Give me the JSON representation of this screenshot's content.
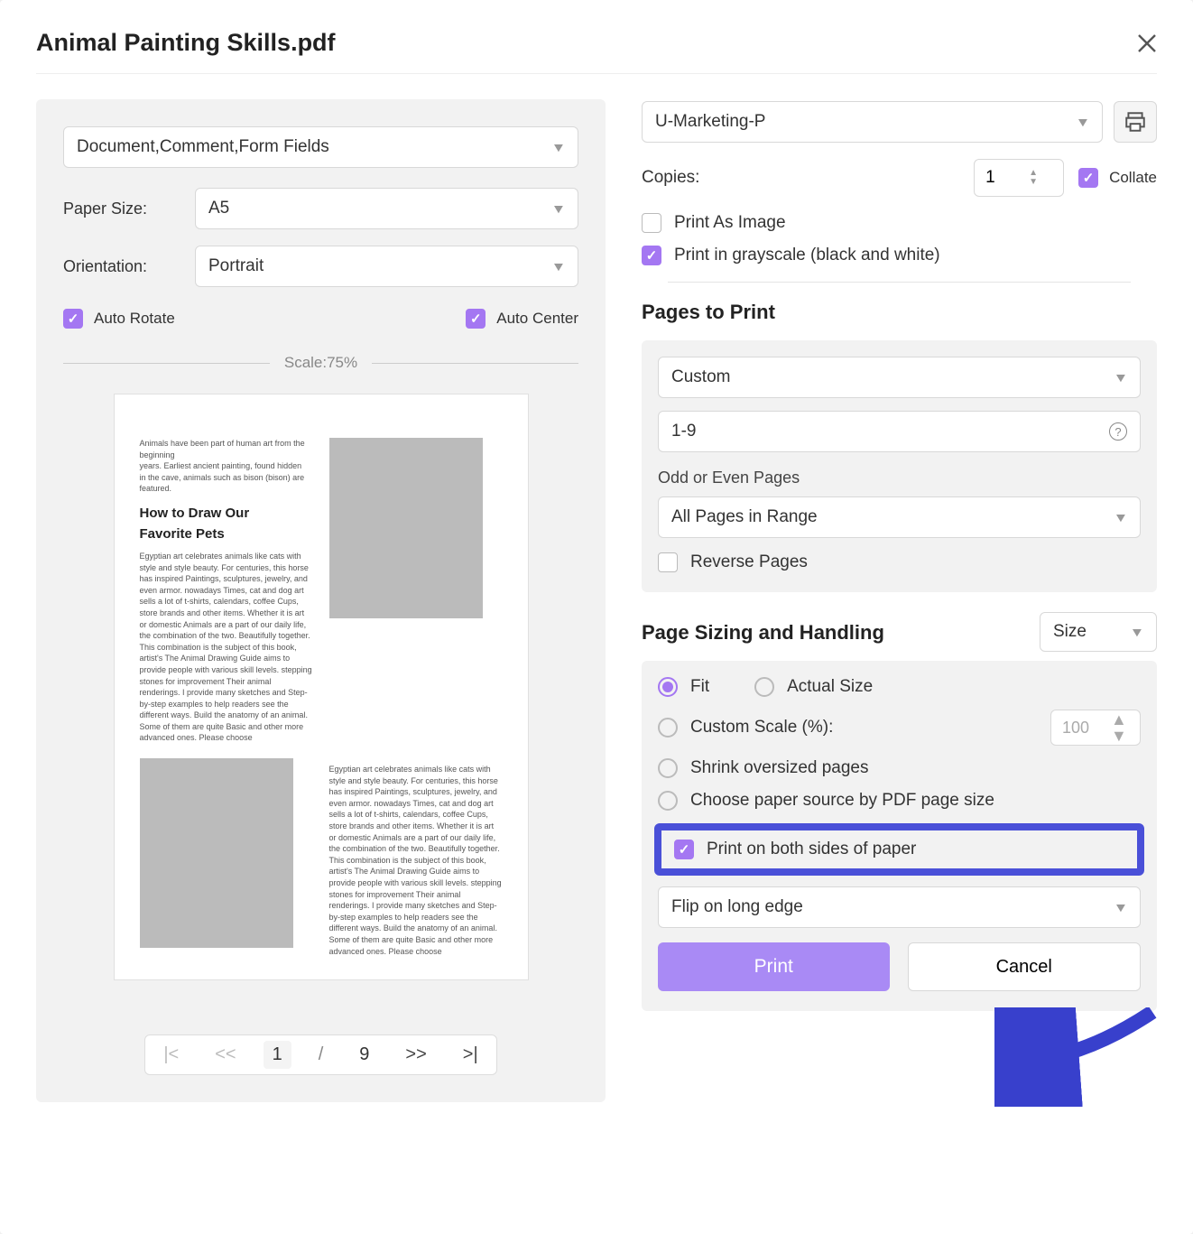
{
  "header": {
    "title": "Animal Painting Skills.pdf"
  },
  "left": {
    "content_select": "Document,Comment,Form Fields",
    "paper_size_label": "Paper Size:",
    "paper_size_value": "A5",
    "orientation_label": "Orientation:",
    "orientation_value": "Portrait",
    "auto_rotate": "Auto Rotate",
    "auto_center": "Auto Center",
    "scale_label": "Scale:75%",
    "preview": {
      "intro1": "Animals have been part of human art from the beginning",
      "intro2": "years. Earliest ancient painting, found hidden",
      "intro3": "in the cave, animals such as bison (bison) are featured.",
      "h3a": "How to Draw Our",
      "h3b": "Favorite Pets",
      "body": "Egyptian art celebrates animals like cats with style and style beauty. For centuries, this horse has inspired Paintings, sculptures, jewelry, and even armor. nowadays Times, cat and dog art sells a lot of t-shirts, calendars, coffee Cups, store brands and other items. Whether it is art or domestic Animals are a part of our daily life, the combination of the two. Beautifully together. This combination is the subject of this book, artist's The Animal Drawing Guide aims to provide people with various skill levels. stepping stones for improvement Their animal renderings. I provide many sketches and Step-by-step examples to help readers see the different ways. Build the anatomy of an animal. Some of them are quite Basic and other more advanced ones. Please choose"
    },
    "pager": {
      "current": "1",
      "sep": "/",
      "total": "9"
    }
  },
  "right": {
    "printer": "U-Marketing-P",
    "copies_label": "Copies:",
    "copies_value": "1",
    "collate": "Collate",
    "print_as_image": "Print As Image",
    "print_grayscale": "Print in grayscale (black and white)",
    "pages_to_print": "Pages to Print",
    "custom": "Custom",
    "page_range": "1-9",
    "odd_even_label": "Odd or Even Pages",
    "all_pages": "All Pages in Range",
    "reverse_pages": "Reverse Pages",
    "page_sizing": "Page Sizing and Handling",
    "size_select": "Size",
    "fit": "Fit",
    "actual_size": "Actual Size",
    "custom_scale": "Custom Scale (%):",
    "custom_scale_value": "100",
    "shrink": "Shrink oversized pages",
    "choose_paper": "Choose paper source by PDF page size",
    "both_sides": "Print on both sides of paper",
    "flip": "Flip on long edge",
    "print_btn": "Print",
    "cancel_btn": "Cancel"
  }
}
